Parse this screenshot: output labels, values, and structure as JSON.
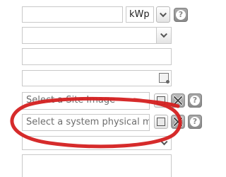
{
  "unit_select": {
    "value": "kWp"
  },
  "site_image": {
    "placeholder": "Select a Site Image"
  },
  "system_map": {
    "placeholder": "Select a system physical ma"
  },
  "icons": {
    "help": "help-icon",
    "close": "close-icon",
    "image_browse": "image-browse-icon",
    "dropdown": "chevron-down-icon"
  },
  "colors": {
    "annotation_ring": "#d42020",
    "icon_gray": "#8a8a8a"
  }
}
